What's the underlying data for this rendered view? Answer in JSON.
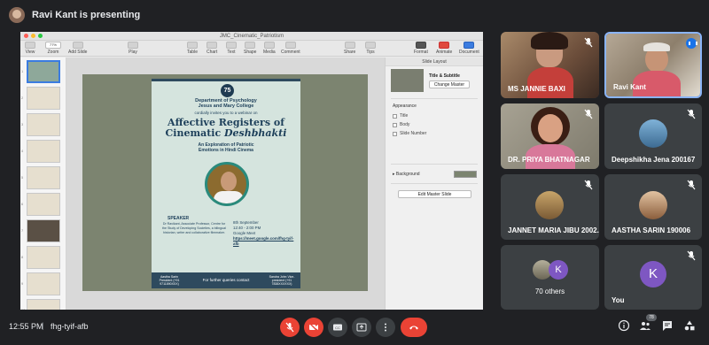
{
  "top": {
    "presenting_text": "Ravi Kant is presenting"
  },
  "keynote": {
    "doc_title": "JMC_Cinematic_Patriotism",
    "toolbar": {
      "view": "View",
      "zoom": "Zoom",
      "zoom_value": "77%",
      "add_slide": "Add Slide",
      "play": "Play",
      "table": "Table",
      "chart": "Chart",
      "text": "Text",
      "shape": "Shape",
      "media": "Media",
      "comment": "Comment",
      "share": "Share",
      "tips": "Tips",
      "format": "Format",
      "animate": "Animate",
      "document": "Document"
    },
    "inspector": {
      "tab": "Slide Layout",
      "section_title": "Title & Subtitle",
      "change_master": "Change Master",
      "appearance": "Appearance",
      "title": "Title",
      "body": "Body",
      "slide_number": "Slide Number",
      "background": "Background",
      "edit_master": "Edit Master Slide"
    },
    "slide_numbers": [
      "1",
      "2",
      "3",
      "4",
      "5",
      "6",
      "7",
      "8",
      "9",
      "10",
      "11"
    ],
    "poster": {
      "badge": "75",
      "dept": "Department of Psychology",
      "college": "Jesus and Mary College",
      "invite": "cordially invites you to a webinar on",
      "title_line1": "Affective Registers of",
      "title_line2_a": "Cinematic ",
      "title_line2_b": "Deshbhakti",
      "sub1": "An Exploration of Patriotic",
      "sub2": "Emotions in Hindi Cinema",
      "sub3": "",
      "speaker_heading": "SPEAKER",
      "speaker_info": "Dr Ravikant, Associate Professor, Centre for the Study of Developing Societies, a bilingual historian, writer and collaborative filmmaker.",
      "event_date": "8th September",
      "event_time": "12:40 - 2:00 PM",
      "event_platform": "Google Meet",
      "event_link": "https://meet.google.com/fhg-tyif-afb",
      "bottom_left": "Aastha Sarin President (+91 9711890XXX)",
      "bottom_mid": "For further queries contact",
      "bottom_right": "Sandra John Vice-president (+91 7838XXXXXX)"
    }
  },
  "participants": [
    {
      "name": "MS JANNIE BAXI"
    },
    {
      "name": "Ravi Kant"
    },
    {
      "name": "DR. PRIYA BHATNAGAR"
    },
    {
      "name": "Deepshikha Jena 200167"
    },
    {
      "name": "JANNET MARIA JIBU 2002..."
    },
    {
      "name": "AASTHA SARIN 190006"
    },
    {
      "name": "70 others",
      "avatar_letter": "K"
    },
    {
      "name": "You",
      "avatar_letter": "K"
    }
  ],
  "bottom": {
    "time": "12:55 PM",
    "separator": "|",
    "meeting_code": "fhg-tyif-afb",
    "participant_count": "78"
  },
  "colors": {
    "meet_bg": "#202124",
    "tile_bg": "#3c4043",
    "danger": "#ea4335",
    "accent": "#1a73e8",
    "avatar_purple": "#7e57c2"
  }
}
